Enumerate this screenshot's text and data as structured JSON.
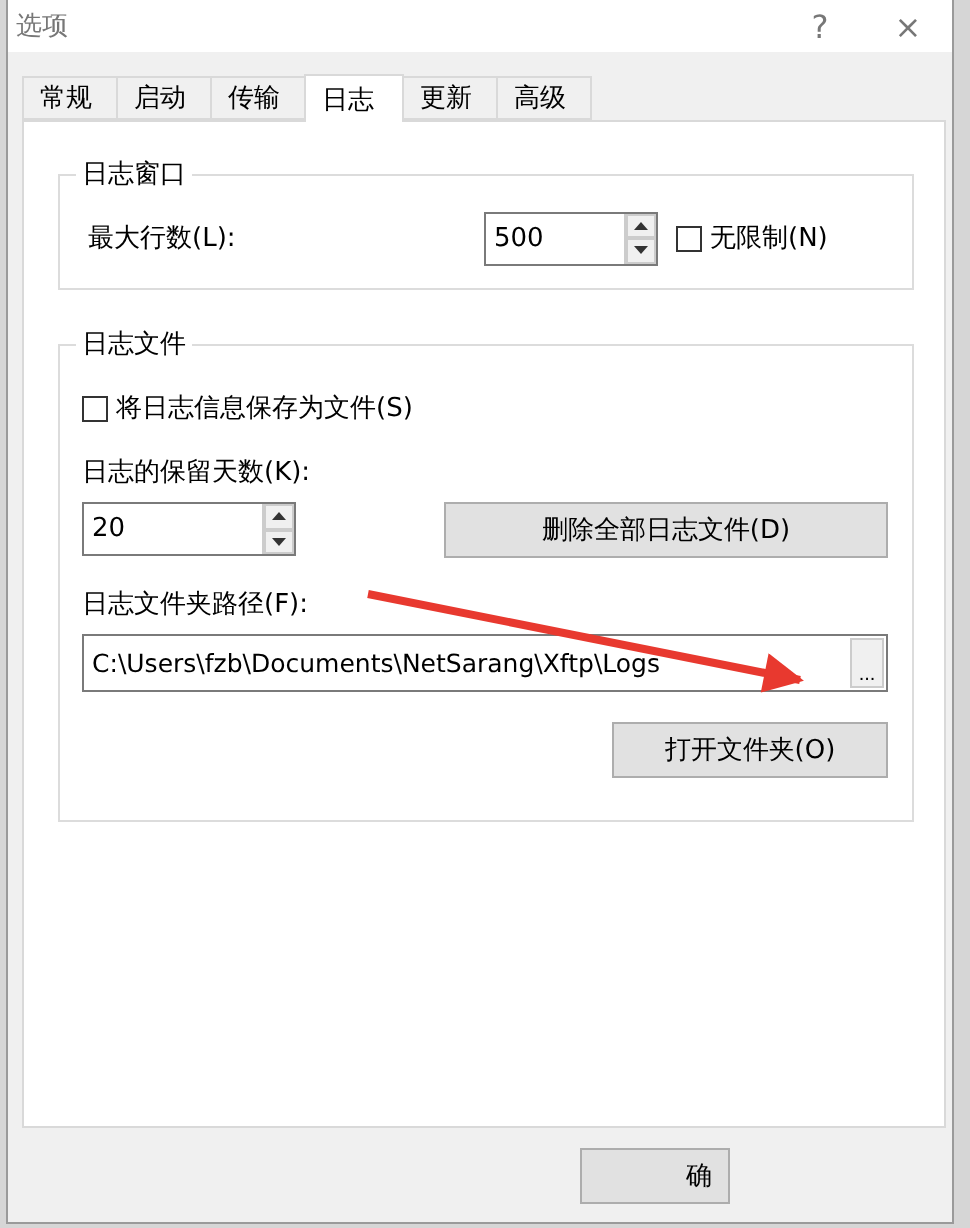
{
  "window": {
    "title": "选项",
    "help": "?",
    "close": "×"
  },
  "tabs": [
    {
      "label": "常规",
      "selected": false
    },
    {
      "label": "启动",
      "selected": false
    },
    {
      "label": "传输",
      "selected": false
    },
    {
      "label": "日志",
      "selected": true
    },
    {
      "label": "更新",
      "selected": false
    },
    {
      "label": "高级",
      "selected": false
    }
  ],
  "log_window": {
    "title": "日志窗口",
    "max_lines_label": "最大行数(L):",
    "max_lines": "500",
    "unlimited": {
      "label": "无限制(N)",
      "checked": false
    }
  },
  "log_file": {
    "title": "日志文件",
    "save_to_file": {
      "label": "将日志信息保存为文件(S)",
      "checked": false
    },
    "keep_days_label": "日志的保留天数(K):",
    "keep_days": "20",
    "delete_button": "删除全部日志文件(D)",
    "folder_label": "日志文件夹路径(F):",
    "folder_path": "C:\\Users\\fzb\\Documents\\NetSarang\\Xftp\\Logs",
    "browse_button": "...",
    "open_folder_button": "打开文件夹(O)"
  },
  "buttons": [
    "确"
  ]
}
